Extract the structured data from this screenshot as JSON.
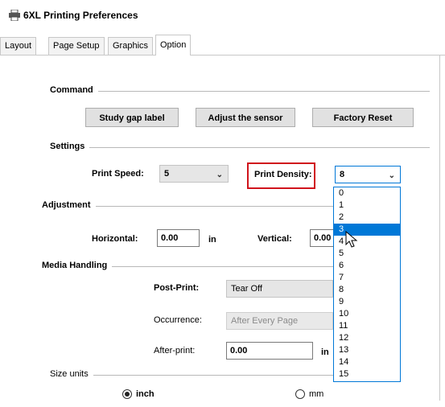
{
  "window": {
    "title": "6XL Printing Preferences"
  },
  "tabs": [
    {
      "label": "Layout"
    },
    {
      "label": "Page Setup"
    },
    {
      "label": "Graphics"
    },
    {
      "label": "Option"
    }
  ],
  "command": {
    "section_label": "Command",
    "study_gap_label": "Study gap label",
    "adjust_sensor_label": "Adjust the sensor",
    "factory_reset_label": "Factory Reset"
  },
  "settings": {
    "section_label": "Settings",
    "print_speed_label": "Print Speed:",
    "print_speed_value": "5",
    "print_density_label": "Print Density:",
    "print_density_value": "8",
    "density_options": [
      "0",
      "1",
      "2",
      "3",
      "4",
      "5",
      "6",
      "7",
      "8",
      "9",
      "10",
      "11",
      "12",
      "13",
      "14",
      "15"
    ],
    "density_highlighted": "3"
  },
  "adjustment": {
    "section_label": "Adjustment",
    "horizontal_label": "Horizontal:",
    "horizontal_value": "0.00",
    "horizontal_unit": "in",
    "vertical_label": "Vertical:",
    "vertical_value": "0.00"
  },
  "media": {
    "section_label": "Media Handling",
    "post_print_label": "Post-Print:",
    "post_print_value": "Tear Off",
    "occurrence_label": "Occurrence:",
    "occurrence_value": "After Every Page",
    "after_print_label": "After-print:",
    "after_print_value": "0.00",
    "after_print_unit": "in"
  },
  "size_units": {
    "section_label": "Size units",
    "inch_label": "inch",
    "mm_label": "mm",
    "selected": "inch"
  },
  "icons": {
    "printer": "printer-icon",
    "cursor": "mouse-pointer-icon",
    "chevron": "chevron-down-icon"
  },
  "colors": {
    "selection": "#0078d7",
    "highlight_border": "#d0141c"
  }
}
